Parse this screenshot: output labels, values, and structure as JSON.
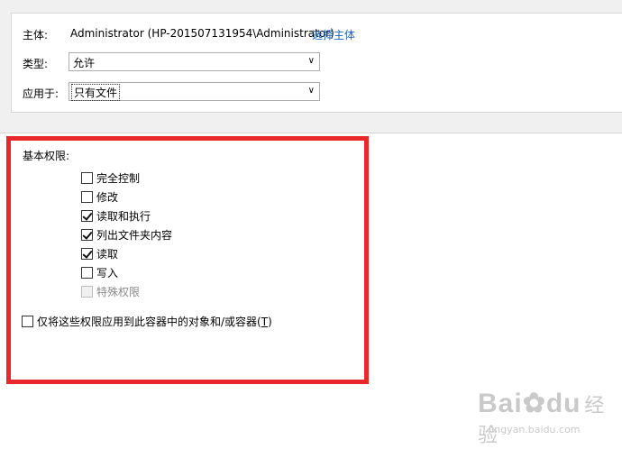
{
  "principal": {
    "label": "主体:",
    "value": "Administrator (HP-201507131954\\Administrator)",
    "select_link": "选择主体"
  },
  "type": {
    "label": "类型:",
    "selected": "允许"
  },
  "applies_to": {
    "label": "应用于:",
    "selected": "只有文件"
  },
  "permissions": {
    "section_label": "基本权限:",
    "items": [
      {
        "label": "完全控制",
        "checked": false,
        "disabled": false
      },
      {
        "label": "修改",
        "checked": false,
        "disabled": false
      },
      {
        "label": "读取和执行",
        "checked": true,
        "disabled": false
      },
      {
        "label": "列出文件夹内容",
        "checked": true,
        "disabled": false
      },
      {
        "label": "读取",
        "checked": true,
        "disabled": false
      },
      {
        "label": "写入",
        "checked": false,
        "disabled": false
      },
      {
        "label": "特殊权限",
        "checked": false,
        "disabled": true
      }
    ]
  },
  "apply_only": {
    "label": "仅将这些权限应用到此容器中的对象和/或容器(",
    "accel": "T",
    "suffix": ")",
    "checked": false
  },
  "watermark": {
    "logo": "Bai",
    "logo2": "du",
    "cn": "经验",
    "url": "jingyan.baidu.com"
  },
  "colors": {
    "link": "#1a62c7",
    "highlight_border": "#e8282b"
  }
}
